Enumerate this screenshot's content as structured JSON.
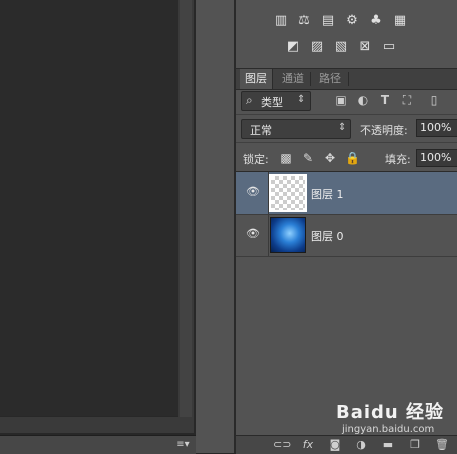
{
  "adjustments": {
    "row1_icons": [
      "levels-icon",
      "balance-icon",
      "hue-icon",
      "photo-filter-icon",
      "channel-mixer-icon",
      "color-lookup-icon"
    ],
    "row2_icons": [
      "invert-icon",
      "posterize-icon",
      "threshold-icon",
      "selective-color-icon",
      "gradient-map-icon"
    ]
  },
  "tabs": [
    {
      "label": "图层",
      "active": true
    },
    {
      "label": "通道",
      "active": false
    },
    {
      "label": "路径",
      "active": false
    }
  ],
  "filter": {
    "search_glyph": "⌕",
    "kind_label": "类型",
    "arrows": "⇕",
    "icons": [
      "image-filter-icon",
      "adjustment-filter-icon",
      "type-filter-icon",
      "shape-filter-icon",
      "smart-object-filter-icon"
    ]
  },
  "blend": {
    "mode": "正常",
    "arrows": "⇕",
    "opacity_label": "不透明度:",
    "opacity_value": "100%"
  },
  "lock": {
    "label": "锁定:",
    "fill_label": "填充:",
    "fill_value": "100%"
  },
  "layers": [
    {
      "name": "图层 1",
      "selected": true,
      "visible": true,
      "thumb": "transparent"
    },
    {
      "name": "图层 0",
      "selected": false,
      "visible": true,
      "thumb": "image"
    }
  ],
  "bottom_bar": {
    "fx_label": "fx",
    "icons": [
      "link-icon",
      "fx-icon",
      "mask-icon",
      "adjustment-layer-icon",
      "group-folder-icon",
      "new-layer-icon",
      "trash-icon"
    ]
  },
  "status": {
    "menu_glyph": "≡▾"
  },
  "watermark": {
    "main": "Baidu 经验",
    "sub": "jingyan.baidu.com"
  },
  "colors": {
    "panel_bg": "#535353",
    "selected_row": "#5a6b80",
    "canvas_bg": "#282828"
  }
}
